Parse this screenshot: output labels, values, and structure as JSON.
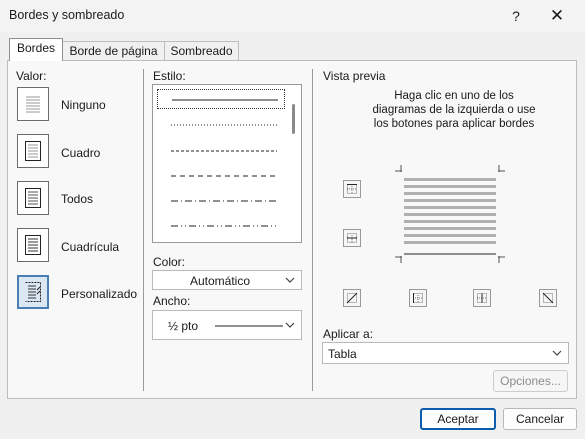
{
  "window": {
    "title": "Bordes y sombreado",
    "help": "?",
    "close": "✕"
  },
  "tabs": [
    {
      "label": "Bordes"
    },
    {
      "label": "Borde de página"
    },
    {
      "label": "Sombreado"
    }
  ],
  "setting": {
    "label": "Valor:",
    "items": [
      {
        "label": "Ninguno",
        "icon": "setting-none-icon"
      },
      {
        "label": "Cuadro",
        "icon": "setting-box-icon"
      },
      {
        "label": "Todos",
        "icon": "setting-all-icon"
      },
      {
        "label": "Cuadrícula",
        "icon": "setting-grid-icon"
      },
      {
        "label": "Personalizado",
        "icon": "setting-custom-icon",
        "selected": true
      }
    ]
  },
  "style": {
    "label": "Estilo:",
    "items": [
      "solid",
      "dotted",
      "dashed-small",
      "dashed",
      "dash-dot",
      "dash-dot-dot"
    ]
  },
  "color": {
    "label": "Color:",
    "value": "Automático"
  },
  "width": {
    "label": "Ancho:",
    "value": "½ pto"
  },
  "preview": {
    "label": "Vista previa",
    "hint": "Haga clic en uno de los diagramas de la izquierda o use los botones para aplicar bordes"
  },
  "apply_to": {
    "label": "Aplicar a:",
    "value": "Tabla"
  },
  "buttons": {
    "options": "Opciones...",
    "ok": "Aceptar",
    "cancel": "Cancelar"
  },
  "colors": {
    "accent": "#0b5cad",
    "selected_bg": "#dbe7f3"
  }
}
